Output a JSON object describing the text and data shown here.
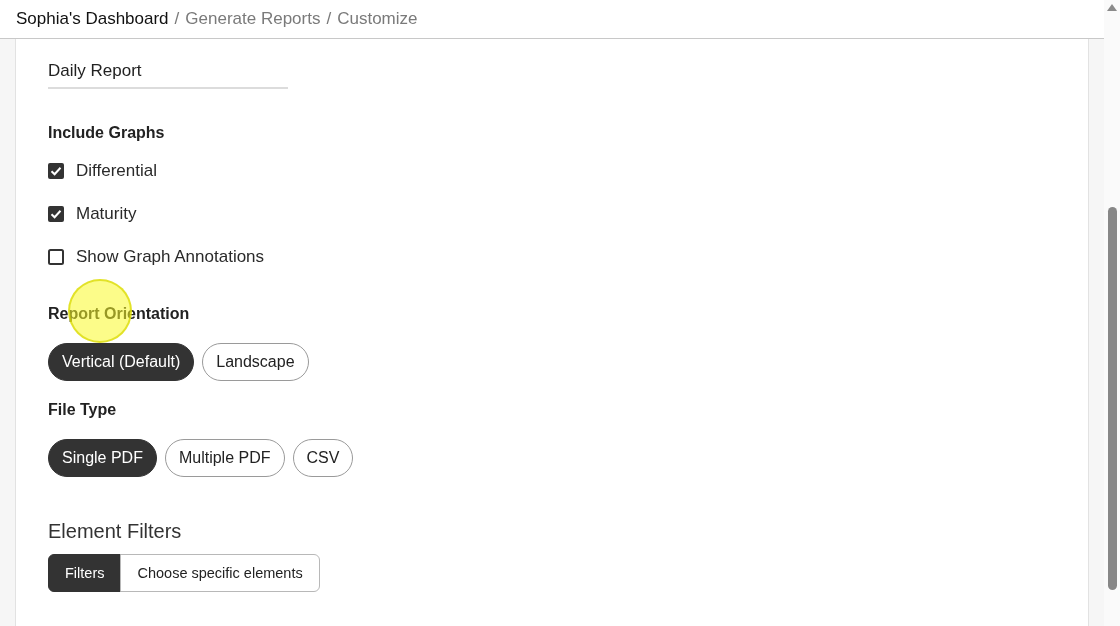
{
  "breadcrumb": [
    {
      "label": "Sophia's Dashboard"
    },
    {
      "separator": "/",
      "label": "Generate Reports"
    },
    {
      "separator": "/",
      "label": "Customize"
    }
  ],
  "label_field": {
    "value": "Daily Report"
  },
  "include_graphs": {
    "title": "Include Graphs",
    "options": [
      {
        "label": "Differential",
        "checked": true
      },
      {
        "label": "Maturity",
        "checked": true
      },
      {
        "label": "Show Graph Annotations",
        "checked": false
      }
    ]
  },
  "report_orientation": {
    "title": "Report Orientation",
    "options": [
      {
        "label": "Vertical (Default)",
        "selected": true
      },
      {
        "label": "Landscape",
        "selected": false
      }
    ]
  },
  "file_type": {
    "title": "File Type",
    "options": [
      {
        "label": "Single PDF",
        "selected": true
      },
      {
        "label": "Multiple PDF",
        "selected": false
      },
      {
        "label": "CSV",
        "selected": false
      }
    ]
  },
  "element_filters": {
    "title": "Element Filters",
    "tabs": [
      {
        "label": "Filters",
        "selected": true
      },
      {
        "label": "Choose specific elements",
        "selected": false
      }
    ]
  }
}
